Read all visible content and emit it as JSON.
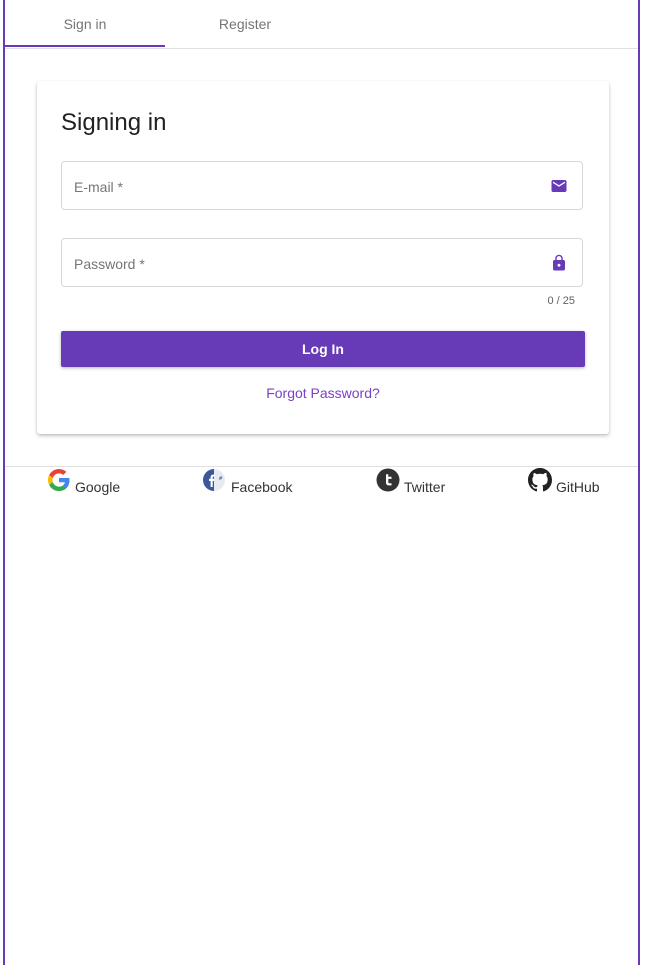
{
  "tabs": [
    {
      "label": "Sign in",
      "selected": true
    },
    {
      "label": "Register",
      "selected": false
    }
  ],
  "card": {
    "title": "Signing in",
    "email": {
      "placeholder": "E-mail *",
      "value": "",
      "icon": "mail-icon"
    },
    "password": {
      "placeholder": "Password *",
      "value": "",
      "icon": "lock-icon",
      "counter": "0 / 25"
    },
    "login_label": "Log In",
    "forgot_label": "Forgot Password?"
  },
  "social": [
    {
      "label": "Google",
      "icon": "google-icon"
    },
    {
      "label": "Facebook",
      "icon": "facebook-icon"
    },
    {
      "label": "Twitter",
      "icon": "twitter-icon"
    },
    {
      "label": "GitHub",
      "icon": "github-icon"
    }
  ],
  "colors": {
    "accent": "#673ab7",
    "link": "#7b40c4",
    "divider": "#e0e0e0"
  }
}
